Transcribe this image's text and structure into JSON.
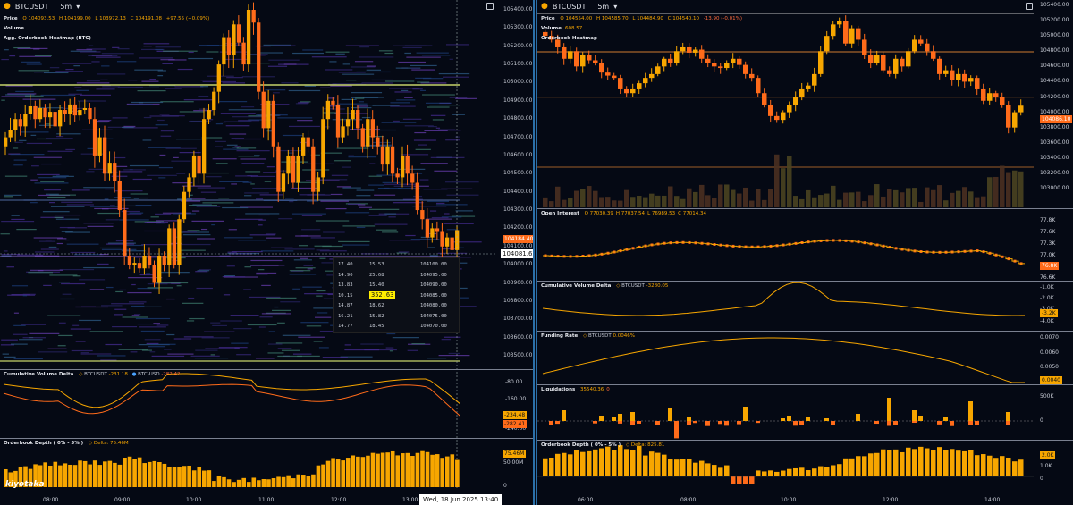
{
  "left": {
    "symbol": "BTCUSDT",
    "interval": "5m",
    "price_info": {
      "label": "Price",
      "o": "O 104093.53",
      "h": "H 104199.00",
      "l": "L 103972.13",
      "c": "C 104191.08",
      "chg": "+97.55 (+0.09%)"
    },
    "volume_label": "Volume",
    "heatmap_label": "Agg. Orderbook Heatmap (BTC)",
    "price_axis": [
      "105400.00",
      "105300.00",
      "105200.00",
      "105100.00",
      "105000.00",
      "104900.00",
      "104800.00",
      "104700.00",
      "104600.00",
      "104500.00",
      "104400.00",
      "104300.00",
      "104200.00",
      "104100.00",
      "104000.00",
      "103900.00",
      "103800.00",
      "103700.00",
      "103600.00",
      "103500.00"
    ],
    "last_price_tag": "104184.40",
    "crosshair_price": "104081.62",
    "orderbook": {
      "rows": [
        {
          "a": "17.40",
          "b": "15.53",
          "p": "104100.00"
        },
        {
          "a": "14.90",
          "b": "25.68",
          "p": "104095.00"
        },
        {
          "a": "13.83",
          "b": "15.40",
          "p": "104090.00"
        },
        {
          "a": "10.15",
          "b": "352.63",
          "p": "104085.00"
        },
        {
          "a": "14.87",
          "b": "18.62",
          "p": "104080.00"
        },
        {
          "a": "16.21",
          "b": "15.82",
          "p": "104075.00"
        },
        {
          "a": "14.77",
          "b": "18.45",
          "p": "104070.00"
        }
      ]
    },
    "cvd": {
      "label": "Cumulative Volume Delta",
      "s1_name": "BTCUSDT",
      "s1_val": "-231.18",
      "s2_name": "BTC-USD",
      "s2_val": "-282.42",
      "axis": [
        "-80.00",
        "-160.00",
        "-240.00"
      ],
      "tag1": "-234.48",
      "tag2": "-282.41"
    },
    "depth": {
      "label": "Orderbook Depth ( 0% - 5% )",
      "delta": "Delta: 75.46M",
      "axis": [
        "50.00M",
        "0"
      ],
      "tag": "75.46M"
    },
    "time_axis": [
      "08:00",
      "09:00",
      "10:00",
      "11:00",
      "12:00",
      "13:00"
    ],
    "crosshair_time": "Wed, 18 Jun 2025 13:40",
    "logo": "kiyotaka"
  },
  "right": {
    "symbol": "BTCUSDT",
    "interval": "5m",
    "price_info": {
      "label": "Price",
      "o": "O 104554.00",
      "h": "H 104585.70",
      "l": "L 104484.90",
      "c": "C 104540.10",
      "chg": "-13.90 (-0.01%)"
    },
    "volume_label": "Volume",
    "volume_val": "608.57",
    "heatmap_label": "Orderbook Heatmap",
    "price_axis": [
      "105400.00",
      "105200.00",
      "105000.00",
      "104800.00",
      "104600.00",
      "104400.00",
      "104200.00",
      "104000.00",
      "103800.00",
      "103600.00",
      "103400.00",
      "103200.00",
      "103000.00"
    ],
    "last_price_tag": "104086.10",
    "oi": {
      "label": "Open Interest",
      "o": "O 77030.39",
      "h": "H 77037.54",
      "l": "L 76989.53",
      "c": "C 77014.34",
      "axis": [
        "77.8K",
        "77.6K",
        "77.3K",
        "77.0K",
        "76.6K"
      ],
      "tag": "76.8K"
    },
    "cvd": {
      "label": "Cumulative Volume Delta",
      "s1_name": "BTCUSDT",
      "s1_val": "-3280.05",
      "axis": [
        "-1.0K",
        "-2.0K",
        "-3.0K",
        "-4.0K"
      ],
      "tag": "-3.2K"
    },
    "funding": {
      "label": "Funding Rate",
      "s1_name": "BTCUSDT",
      "s1_val": "0.0046%",
      "axis": [
        "0.0070",
        "0.0060",
        "0.0050"
      ],
      "tag": "0.0040"
    },
    "liq": {
      "label": "Liquidations",
      "val": "35540.36",
      "val2": "0",
      "axis": [
        "500K",
        "0"
      ]
    },
    "depth": {
      "label": "Orderbook Depth ( 0% - 5% )",
      "delta": "Delta: 825.81",
      "axis": [
        "2.0K",
        "1.0K",
        "0"
      ],
      "tag": "2.0K"
    },
    "time_axis": [
      "06:00",
      "08:00",
      "10:00",
      "12:00",
      "14:00"
    ]
  },
  "colors": {
    "up": "#f7a600",
    "down": "#ff6b1a",
    "bg": "#050914",
    "accent": "#2b6fa8"
  }
}
